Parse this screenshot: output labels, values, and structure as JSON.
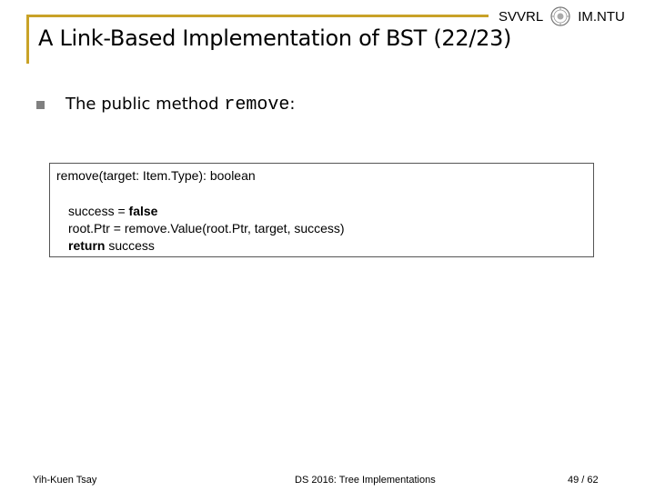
{
  "header": {
    "org_left": "SVVRL",
    "org_right": "IM.NTU",
    "seal_icon": "university-seal-icon"
  },
  "title": "A Link-Based Implementation of BST (22/23)",
  "bullet": {
    "text_prefix": "The public method ",
    "code": "remove",
    "text_suffix": ":"
  },
  "code_box": {
    "signature": "remove(target: Item.Type): boolean",
    "line1_pre": "success = ",
    "line1_kw": "false",
    "line2": "root.Ptr = remove.Value(root.Ptr, target, success)",
    "line3_kw": "return",
    "line3_post": " success"
  },
  "footer": {
    "author": "Yih-Kuen Tsay",
    "course": "DS 2016: Tree Implementations",
    "page": "49 / 62"
  },
  "colors": {
    "accent_rule": "#c9a227",
    "bullet": "#808080",
    "box_border": "#555555"
  }
}
